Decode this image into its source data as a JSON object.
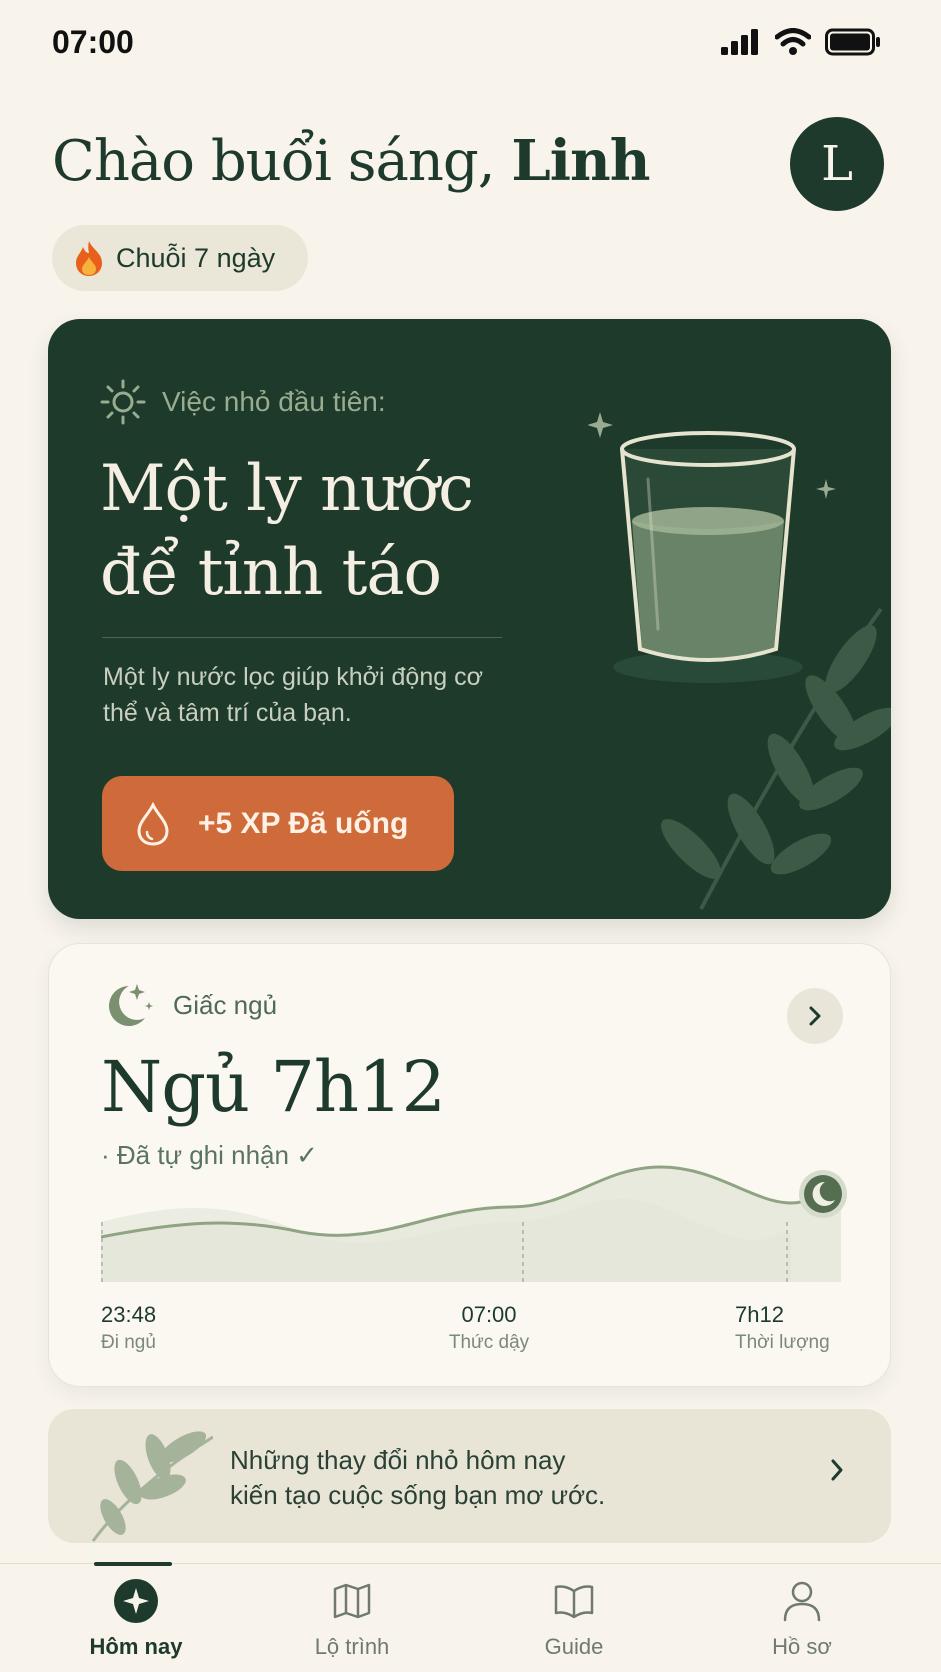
{
  "status": {
    "time": "07:00"
  },
  "header": {
    "greeting": "Chào buổi sáng, ",
    "name": "Linh",
    "avatar_initial": "L"
  },
  "streak": {
    "label": "Chuỗi 7 ngày",
    "icon": "fire-icon"
  },
  "task": {
    "label": "Việc nhỏ đầu tiên:",
    "title_line1": "Một ly nước",
    "title_line2": "để tỉnh táo",
    "description": "Một ly nước lọc giúp khởi động cơ thể và tâm trí của bạn.",
    "button_label": "+5 XP Đã uống",
    "icon": "water-drop-icon"
  },
  "sleep": {
    "label": "Giấc ngủ",
    "title": "Ngủ 7h12",
    "auto_note": "· Đã tự ghi nhận ✓",
    "stats": [
      {
        "value": "23:48",
        "label": "Đi ngủ"
      },
      {
        "value": "07:00",
        "label": "Thức dậy"
      },
      {
        "value": "7h12",
        "label": "Thời lượng"
      }
    ]
  },
  "quote": {
    "line1": "Những thay đổi nhỏ hôm nay",
    "line2": "kiến tạo cuộc sống bạn mơ ước."
  },
  "tabs": [
    {
      "label": "Hôm nay",
      "icon": "sparkle-icon",
      "active": true
    },
    {
      "label": "Lộ trình",
      "icon": "map-icon"
    },
    {
      "label": "Guide",
      "icon": "book-icon"
    },
    {
      "label": "Hồ sơ",
      "icon": "user-icon"
    }
  ],
  "colors": {
    "primary": "#1e3a2b",
    "accent": "#cf6a3b",
    "background": "#f8f4ec",
    "sage": "#8fa483"
  }
}
